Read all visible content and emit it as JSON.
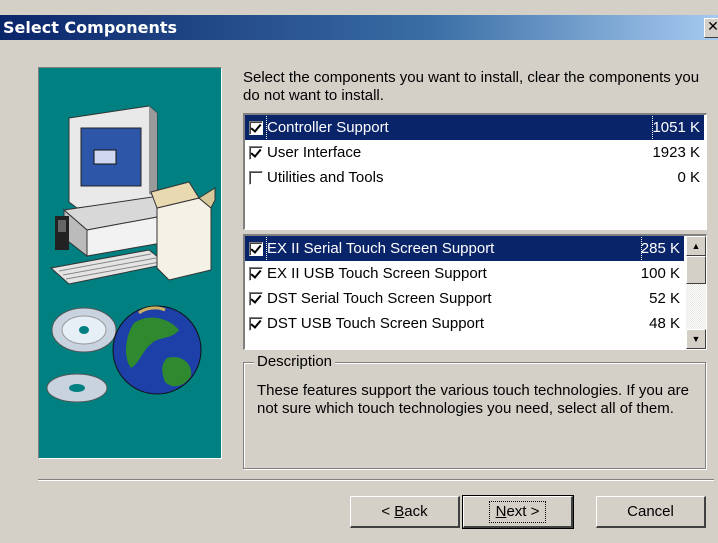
{
  "window": {
    "title": "Select Components",
    "close_glyph": "✕"
  },
  "instructions": "Select the components you want to install, clear the components you do not want to install.",
  "components": [
    {
      "label": "Controller Support",
      "size": "1051 K",
      "checked": true,
      "selected": true
    },
    {
      "label": "User Interface",
      "size": "1923 K",
      "checked": true,
      "selected": false
    },
    {
      "label": "Utilities and Tools",
      "size": "0 K",
      "checked": false,
      "selected": false
    }
  ],
  "subcomponents": [
    {
      "label": "EX II Serial Touch Screen Support",
      "size": "285 K",
      "checked": true,
      "selected": true
    },
    {
      "label": "EX II USB Touch Screen Support",
      "size": "100 K",
      "checked": true,
      "selected": false
    },
    {
      "label": "DST Serial Touch Screen Support",
      "size": "52 K",
      "checked": true,
      "selected": false
    },
    {
      "label": "DST USB Touch Screen Support",
      "size": "48 K",
      "checked": true,
      "selected": false
    }
  ],
  "scrollbar": {
    "up_icon": "triangle-up-icon",
    "down_icon": "triangle-down-icon"
  },
  "description": {
    "legend": "Description",
    "text": "These features support the various touch technologies. If you are not sure which touch technologies you need, select all of them."
  },
  "buttons": {
    "back": {
      "prefix": "< ",
      "mnemonic": "B",
      "rest": "ack"
    },
    "next": {
      "mnemonic": "N",
      "rest": "ext >"
    },
    "cancel": "Cancel"
  },
  "colors": {
    "title_bar_start": "#0a246a",
    "title_bar_end": "#a6caf0",
    "art_background": "#008080",
    "selection": "#0a246a",
    "dialog_face": "#d4d0c8"
  }
}
